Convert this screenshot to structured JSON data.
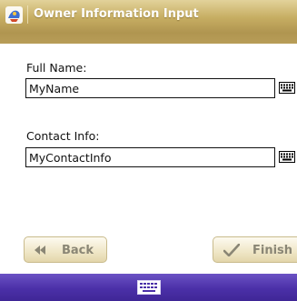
{
  "window": {
    "title": "Owner Information Input",
    "app_icon": "app-icon"
  },
  "form": {
    "full_name_label": "Full Name:",
    "full_name_value": "MyName",
    "contact_info_label": "Contact Info:",
    "contact_info_value": "MyContactInfo",
    "keyboard_icon": "keyboard-icon"
  },
  "buttons": {
    "back_label": "Back",
    "back_icon": "double-left-arrow-icon",
    "finish_label": "Finish",
    "finish_icon": "checkmark-icon"
  },
  "bottombar": {
    "sip_icon": "keyboard-icon"
  },
  "colors": {
    "title_bar": "#c2a85c",
    "bottom_bar": "#4b30a8",
    "button_face": "#efe6c6",
    "button_text": "#8a8675"
  }
}
